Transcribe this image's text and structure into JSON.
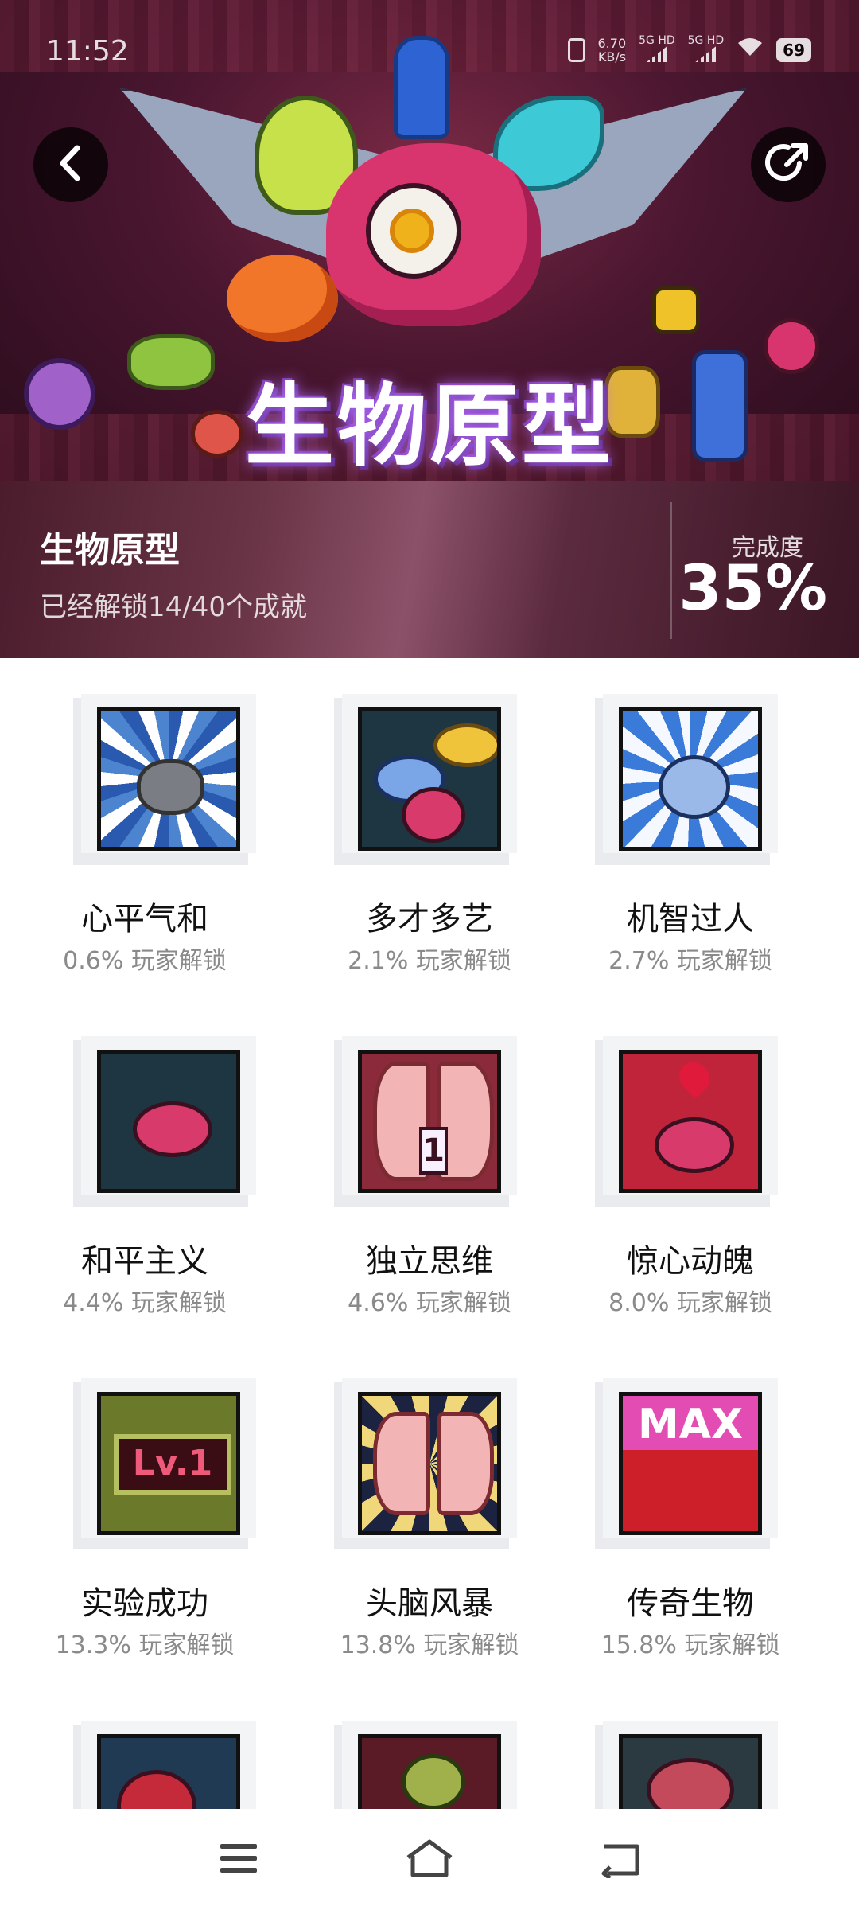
{
  "status_bar": {
    "time": "11:52",
    "net_speed": "6.70",
    "net_speed_unit": "KB/s",
    "sim1": "5G HD",
    "sim2": "5G HD",
    "battery": "69"
  },
  "hero": {
    "logo_text": "生物原型"
  },
  "header": {
    "back_icon": "chevron-left-icon",
    "share_icon": "share-icon"
  },
  "info": {
    "title": "生物原型",
    "subtitle": "已经解锁14/40个成就",
    "completion_label": "完成度",
    "completion_value": "35%",
    "completion_fraction": 0.35
  },
  "achievements": [
    {
      "name": "心平气和",
      "rate": "0.6% 玩家解锁"
    },
    {
      "name": "多才多艺",
      "rate": "2.1% 玩家解锁"
    },
    {
      "name": "机智过人",
      "rate": "2.7% 玩家解锁"
    },
    {
      "name": "和平主义",
      "rate": "4.4% 玩家解锁"
    },
    {
      "name": "独立思维",
      "rate": "4.6% 玩家解锁"
    },
    {
      "name": "惊心动魄",
      "rate": "8.0% 玩家解锁"
    },
    {
      "name": "实验成功",
      "rate": "13.3% 玩家解锁"
    },
    {
      "name": "头脑风暴",
      "rate": "13.8% 玩家解锁"
    },
    {
      "name": "传奇生物",
      "rate": "15.8% 玩家解锁"
    }
  ],
  "badge_text": {
    "brain_number": "1",
    "level": "Lv.1",
    "max": "MAX"
  },
  "nav": {
    "menu_icon": "menu-icon",
    "home_icon": "home-icon",
    "back_icon": "back-arrow-icon"
  }
}
